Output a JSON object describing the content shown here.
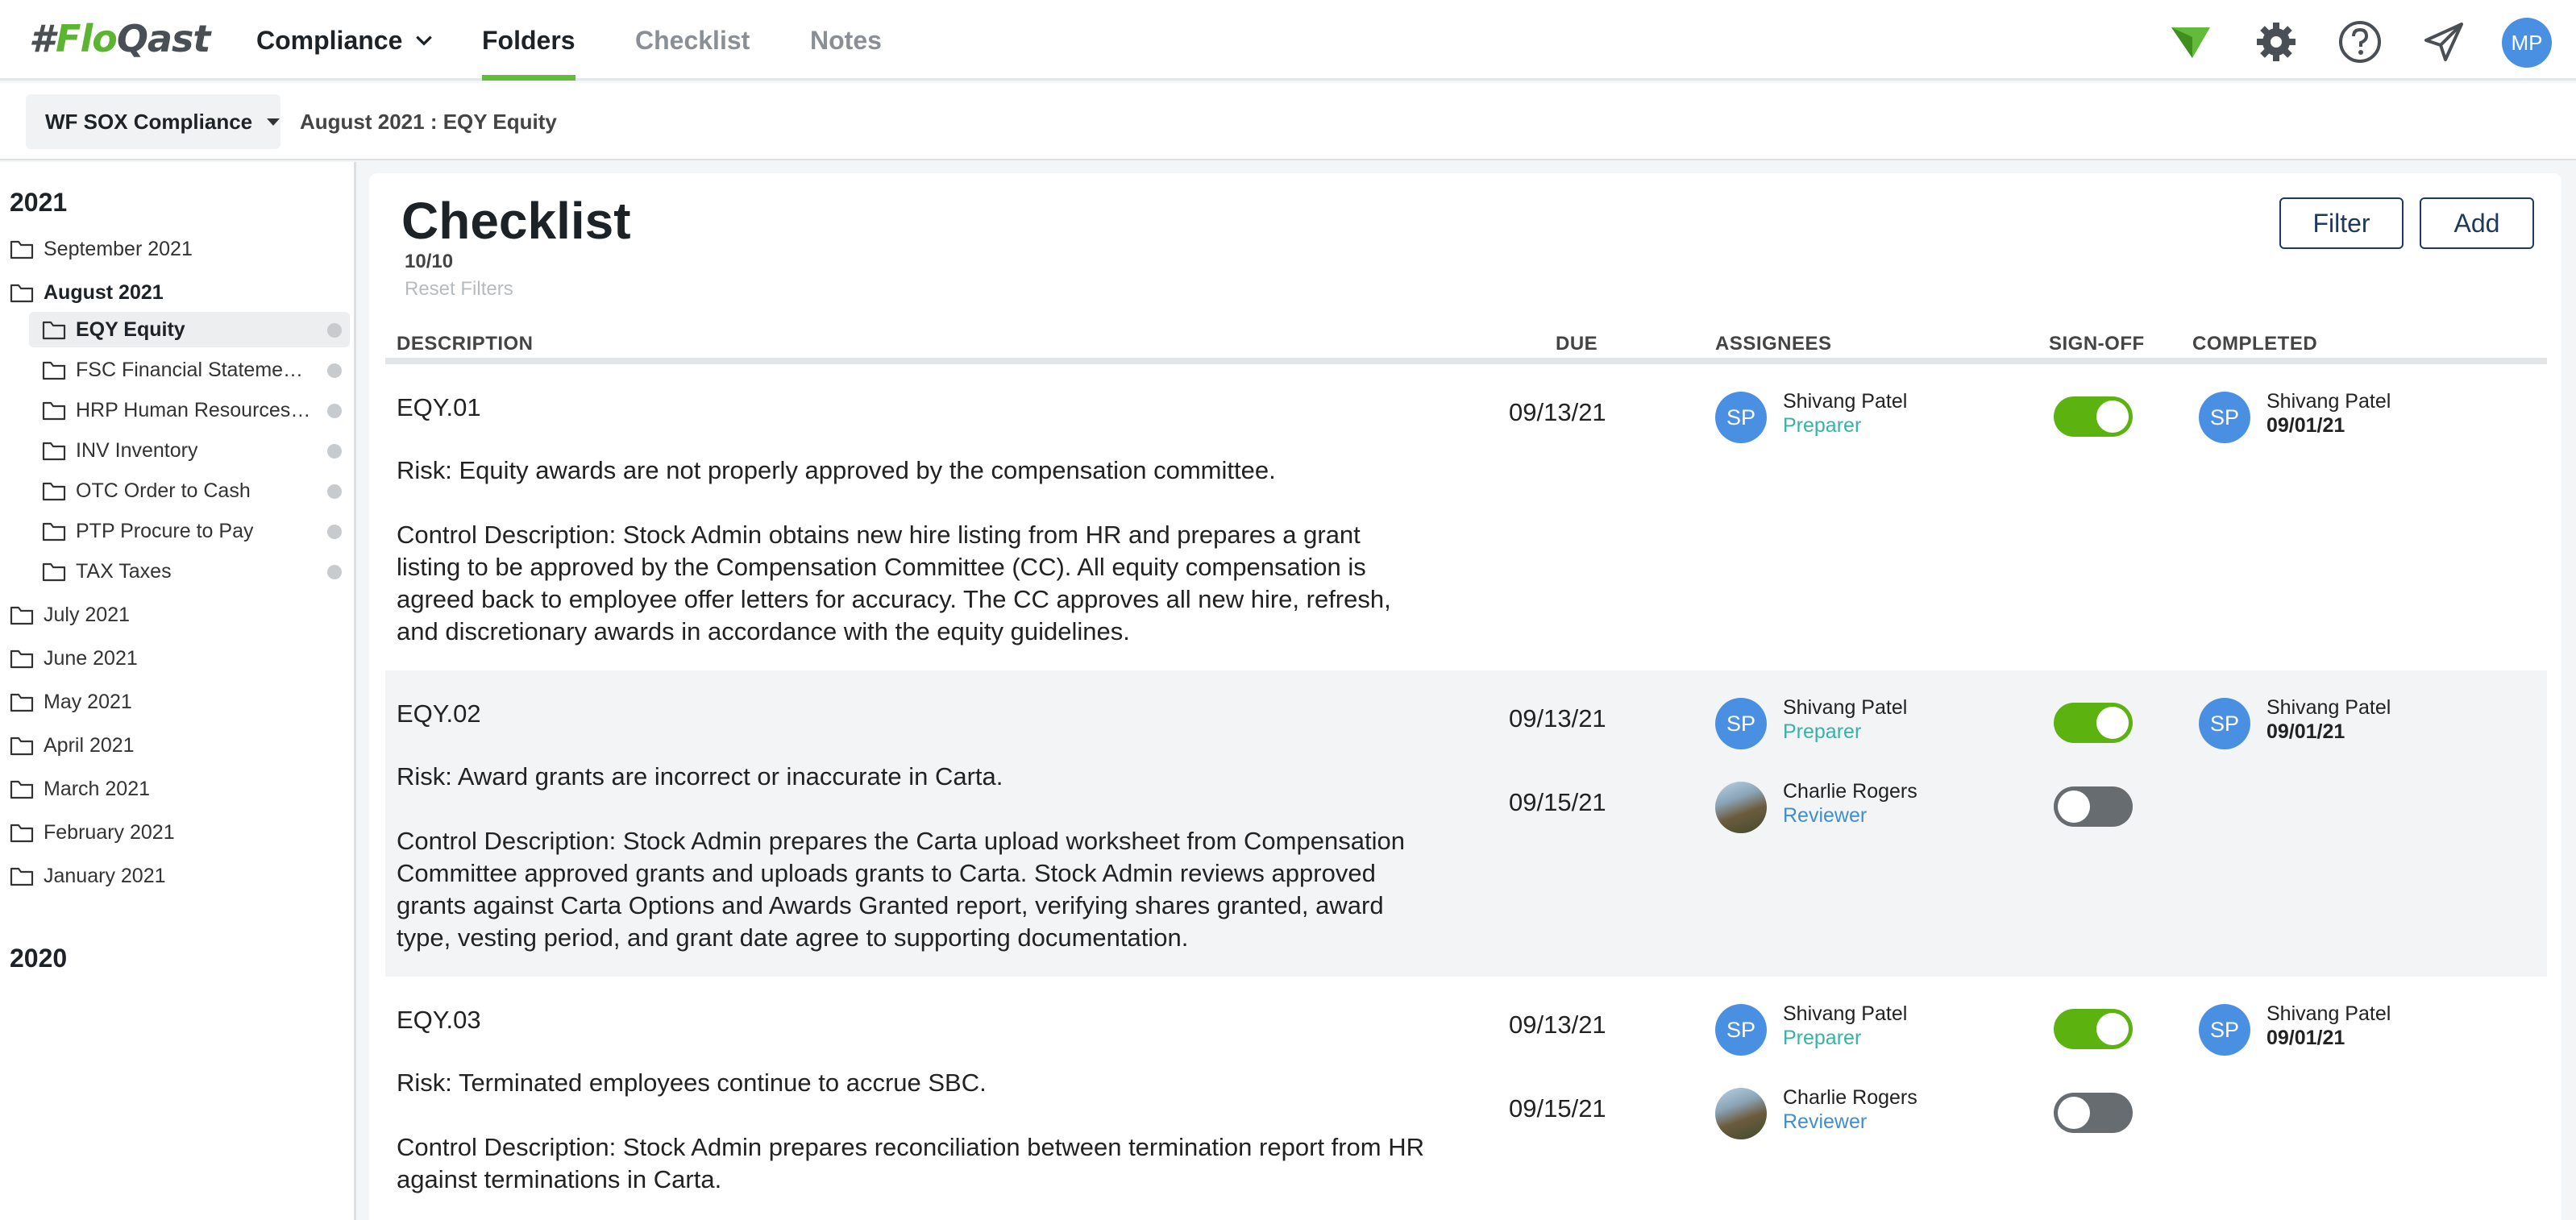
{
  "nav": {
    "logo_hash": "#",
    "logo_fl": "Flo",
    "logo_rest": "Qast",
    "compliance": "Compliance",
    "folders": "Folders",
    "checklist": "Checklist",
    "notes": "Notes",
    "user_initials": "MP"
  },
  "subbar": {
    "workspace": "WF SOX Compliance",
    "breadcrumb": "August 2021 : EQY Equity"
  },
  "sidebar": {
    "year_2021": "2021",
    "year_2020": "2020",
    "months": [
      {
        "label": "September 2021"
      },
      {
        "label": "August 2021"
      },
      {
        "label": "July 2021"
      },
      {
        "label": "June 2021"
      },
      {
        "label": "May 2021"
      },
      {
        "label": "April 2021"
      },
      {
        "label": "March 2021"
      },
      {
        "label": "February 2021"
      },
      {
        "label": "January 2021"
      }
    ],
    "folders": [
      {
        "label": "EQY Equity"
      },
      {
        "label": "FSC Financial Statement ..."
      },
      {
        "label": "HRP Human Resources a..."
      },
      {
        "label": "INV Inventory"
      },
      {
        "label": "OTC Order to Cash"
      },
      {
        "label": "PTP Procure to Pay"
      },
      {
        "label": "TAX Taxes"
      }
    ]
  },
  "main": {
    "title": "Checklist",
    "count": "10/10",
    "reset": "Reset Filters",
    "filter_btn": "Filter",
    "add_btn": "Add",
    "columns": {
      "description": "DESCRIPTION",
      "due": "DUE",
      "assignees": "ASSIGNEES",
      "signoff": "SIGN-OFF",
      "completed": "COMPLETED"
    },
    "rows": [
      {
        "code": "EQY.01",
        "risk": "Risk: Equity awards are not properly approved by the compensation committee.",
        "control": "Control Description: Stock Admin obtains new hire listing from HR and prepares a grant listing to be approved by the Compensation Committee (CC). All equity compensation is agreed back to employee offer letters for accuracy. The CC approves all new hire, refresh, and discretionary awards in accordance with the equity guidelines.",
        "assignees": [
          {
            "due": "09/13/21",
            "initials": "SP",
            "name": "Shivang Patel",
            "role": "Preparer",
            "signed": true,
            "completed_initials": "SP",
            "completed_name": "Shivang Patel",
            "completed_date": "09/01/21"
          }
        ]
      },
      {
        "code": "EQY.02",
        "risk": "Risk: Award grants are incorrect or inaccurate in Carta.",
        "control": "Control Description: Stock Admin prepares the Carta upload worksheet from Compensation Committee approved grants and uploads grants to Carta. Stock Admin reviews approved grants against Carta Options and Awards Granted report, verifying shares granted, award type, vesting period, and grant date agree to supporting documentation.",
        "assignees": [
          {
            "due": "09/13/21",
            "initials": "SP",
            "name": "Shivang Patel",
            "role": "Preparer",
            "signed": true,
            "completed_initials": "SP",
            "completed_name": "Shivang Patel",
            "completed_date": "09/01/21"
          },
          {
            "due": "09/15/21",
            "initials": "",
            "name": "Charlie Rogers",
            "role": "Reviewer",
            "signed": false
          }
        ]
      },
      {
        "code": "EQY.03",
        "risk": "Risk: Terminated employees continue to accrue SBC.",
        "control": "Control Description: Stock Admin prepares reconciliation between termination report from HR against terminations in Carta.",
        "assignees": [
          {
            "due": "09/13/21",
            "initials": "SP",
            "name": "Shivang Patel",
            "role": "Preparer",
            "signed": true,
            "completed_initials": "SP",
            "completed_name": "Shivang Patel",
            "completed_date": "09/01/21"
          },
          {
            "due": "09/15/21",
            "initials": "",
            "name": "Charlie Rogers",
            "role": "Reviewer",
            "signed": false
          }
        ]
      }
    ]
  },
  "icons": [
    "filter-icon",
    "gear-icon",
    "help-icon",
    "send-icon",
    "folder-icon",
    "chevron-down-icon"
  ],
  "colors": {
    "accent": "#62bb3a",
    "toggle_on": "#5cb30f",
    "avatar": "#4a90e2",
    "preparer": "#38b2a6",
    "reviewer": "#3f8fd0"
  }
}
